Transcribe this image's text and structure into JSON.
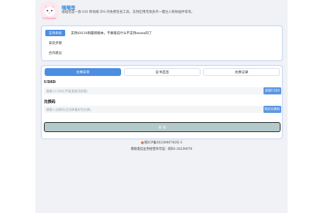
{
  "header": {
    "title": "喵喵签",
    "description": "喵喵签是一款 iOS 移动端 IPA 的免费签名工具，支持应用无限多开一键注入移除插件等等。",
    "logo_text": "Hi Miaoqian"
  },
  "menu": {
    "items": [
      {
        "label": "支持系统",
        "active": true
      },
      {
        "label": "安装步骤",
        "active": false
      },
      {
        "label": "合作建议",
        "active": false
      }
    ],
    "notice": "支持iOS10到最新版本，不要再说什么不支持xxxxx的了"
  },
  "tabs": [
    {
      "label": "兑换安装",
      "active": true
    },
    {
      "label": "证书自签",
      "active": false
    },
    {
      "label": "兑换记录",
      "active": false
    }
  ],
  "udid": {
    "label": "UDID",
    "placeholder": "请输入UDID(不知道请点获取)",
    "button": "获取UDID"
  },
  "code": {
    "label": "兑换码",
    "placeholder": "请输入兑换码(已兑换最好别兑换)",
    "button": "购买兑换码"
  },
  "submit_label": "安 装",
  "footer": {
    "icp": "皖ICP备2023000745号-3",
    "license": "增值电信业务经营许可证：皖B2-20230070"
  },
  "colors": {
    "accent": "#4b8ee0",
    "title": "#2e86de",
    "submit_bg": "#b4c9c9"
  }
}
